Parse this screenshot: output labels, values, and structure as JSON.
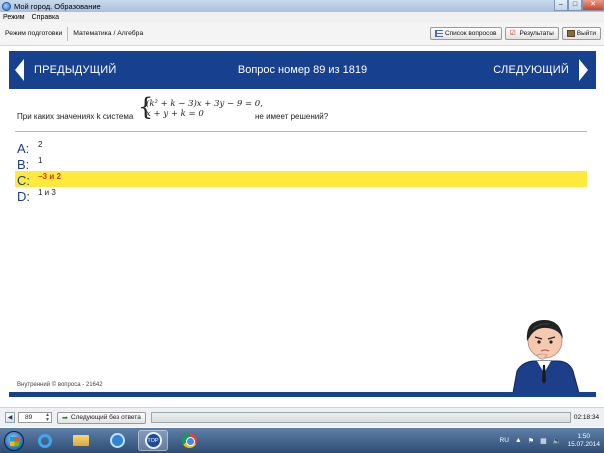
{
  "window": {
    "title": "Мой город. Образование",
    "controls": [
      "–",
      "□",
      "✕"
    ]
  },
  "menu": [
    "Режим",
    "Справка"
  ],
  "toolbar": {
    "mode": "Режим подготовки",
    "subject": "Математика / Алгебра",
    "buttons": {
      "list": "Список вопросов",
      "results": "Результаты",
      "exit": "Выйти"
    }
  },
  "nav": {
    "prev": "ПРЕДЫДУЩИЙ",
    "title": "Вопрос номер 89 из 1819",
    "next": "СЛЕДУЮЩИЙ"
  },
  "question": {
    "before": "При каких значениях k система",
    "eq1": "(k² + k − 3)x + 3y − 9 = 0,",
    "eq2": "x + y + k = 0",
    "after": "не имеет решений?"
  },
  "answers": [
    {
      "letter": "A:",
      "text": "2",
      "selected": false
    },
    {
      "letter": "B:",
      "text": "1",
      "selected": false
    },
    {
      "letter": "C:",
      "text": "−3 и 2",
      "selected": true
    },
    {
      "letter": "D:",
      "text": "1 и 3",
      "selected": false
    }
  ],
  "footer": {
    "copyright": "Внутренний © вопроса - 21642"
  },
  "statusbar": {
    "question_number": "89",
    "skip": "Следующий без ответа",
    "progress": 0.0,
    "time": "02:18:34"
  },
  "taskbar": {
    "lang": "RU",
    "time": "1:50",
    "date": "15.07.2014",
    "player_label": "TOP"
  },
  "colors": {
    "header": "#17418f",
    "highlight": "#ffe93a",
    "selected_text": "#d23a12",
    "letter": "#1a3e8c"
  }
}
